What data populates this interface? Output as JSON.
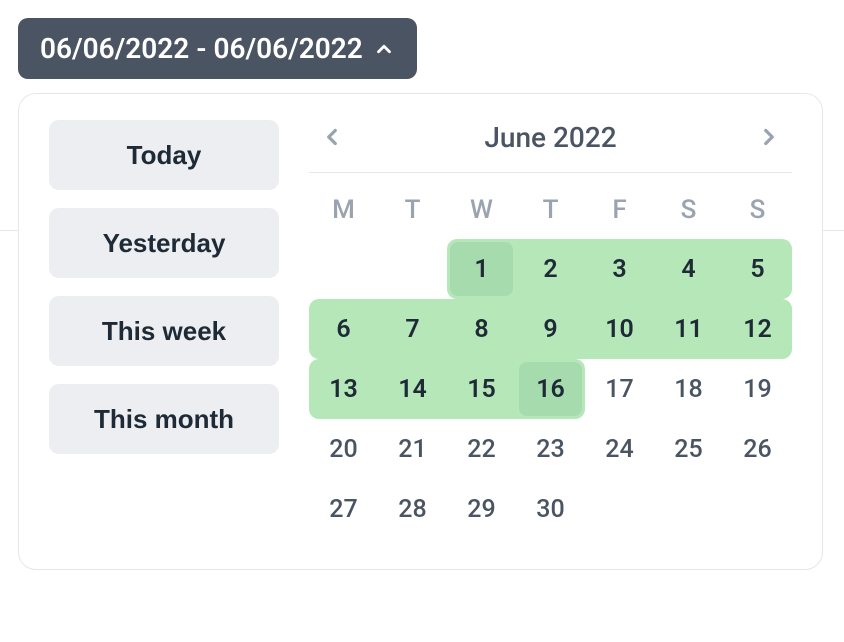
{
  "trigger": {
    "range_label": "06/06/2022 - 06/06/2022"
  },
  "presets": [
    {
      "label": "Today"
    },
    {
      "label": "Yesterday"
    },
    {
      "label": "This week"
    },
    {
      "label": "This month"
    }
  ],
  "calendar": {
    "month_label": "June 2022",
    "dow": [
      "M",
      "T",
      "W",
      "T",
      "F",
      "S",
      "S"
    ],
    "leading_blanks": 2,
    "days_in_month": 30,
    "range_start_day": 1,
    "range_end_day": 16,
    "muted_from_day": 17
  }
}
